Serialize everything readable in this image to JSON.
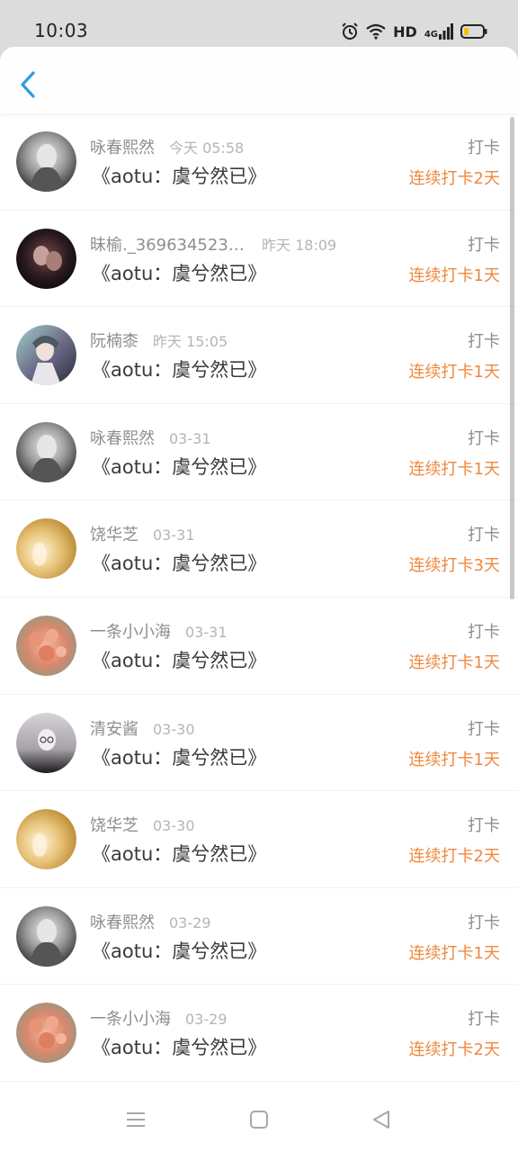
{
  "status_bar": {
    "time": "10:03",
    "hd": "HD",
    "network": "4G"
  },
  "items": [
    {
      "name": "咏春熙然",
      "time": "今天 05:58",
      "title": "《aotu：虞兮然已》",
      "action": "打卡",
      "streak": "连续打卡2天",
      "avatar": "avatar-grayscale-woman"
    },
    {
      "name": "昧榆._3696345238...",
      "time": "昨天 18:09",
      "title": "《aotu：虞兮然已》",
      "action": "打卡",
      "streak": "连续打卡1天",
      "avatar": "avatar-dark-couple"
    },
    {
      "name": "阮楠桼",
      "time": "昨天 15:05",
      "title": "《aotu：虞兮然已》",
      "action": "打卡",
      "streak": "连续打卡1天",
      "avatar": "avatar-anime-character"
    },
    {
      "name": "咏春熙然",
      "time": "03-31",
      "title": "《aotu：虞兮然已》",
      "action": "打卡",
      "streak": "连续打卡1天",
      "avatar": "avatar-grayscale-woman"
    },
    {
      "name": "饶华芝",
      "time": "03-31",
      "title": "《aotu：虞兮然已》",
      "action": "打卡",
      "streak": "连续打卡3天",
      "avatar": "avatar-warm-light"
    },
    {
      "name": "一条小小海",
      "time": "03-31",
      "title": "《aotu：虞兮然已》",
      "action": "打卡",
      "streak": "连续打卡1天",
      "avatar": "avatar-flowers"
    },
    {
      "name": "清安酱",
      "time": "03-30",
      "title": "《aotu：虞兮然已》",
      "action": "打卡",
      "streak": "连续打卡1天",
      "avatar": "avatar-anime-glasses"
    },
    {
      "name": "饶华芝",
      "time": "03-30",
      "title": "《aotu：虞兮然已》",
      "action": "打卡",
      "streak": "连续打卡2天",
      "avatar": "avatar-warm-light"
    },
    {
      "name": "咏春熙然",
      "time": "03-29",
      "title": "《aotu：虞兮然已》",
      "action": "打卡",
      "streak": "连续打卡1天",
      "avatar": "avatar-grayscale-woman"
    },
    {
      "name": "一条小小海",
      "time": "03-29",
      "title": "《aotu：虞兮然已》",
      "action": "打卡",
      "streak": "连续打卡2天",
      "avatar": "avatar-flowers"
    }
  ],
  "colors": {
    "accent": "#2e9be6",
    "streak": "#f0883e",
    "name": "#8e8e8e",
    "title": "#3a3a3a"
  }
}
